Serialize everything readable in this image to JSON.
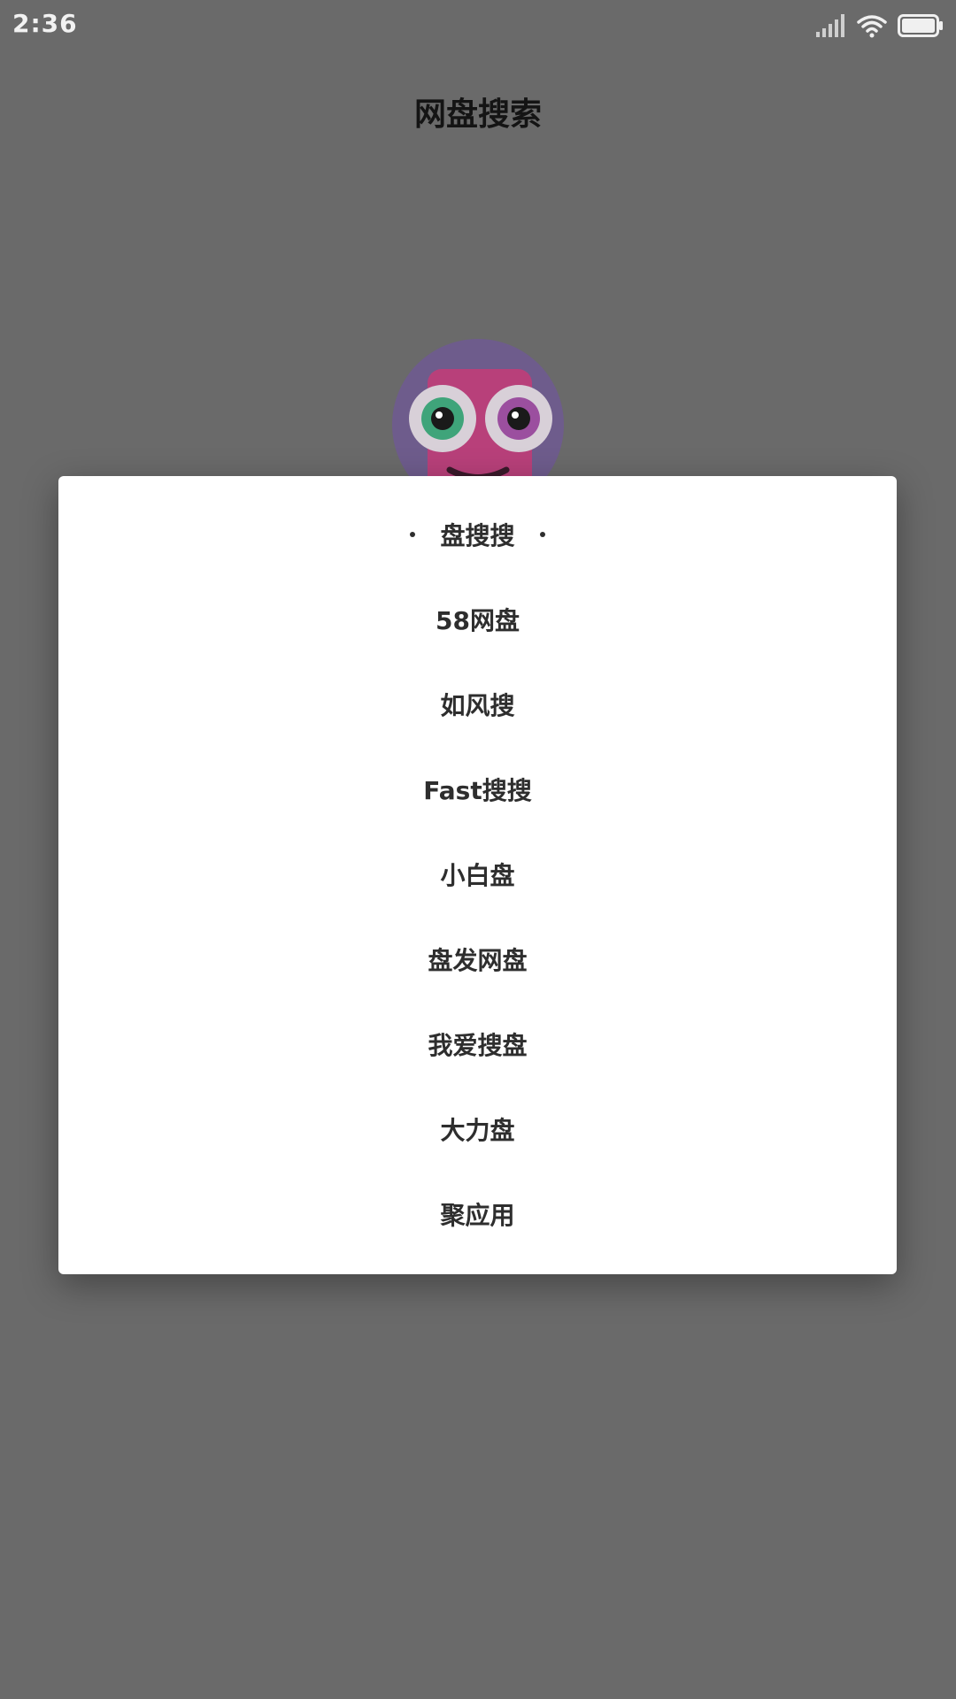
{
  "status_bar": {
    "time": "2:36",
    "icons": [
      "signal-icon",
      "wifi-icon",
      "battery-icon"
    ],
    "battery_level": 1.0
  },
  "header": {
    "title": "网盘搜索"
  },
  "colors": {
    "overlay": "#6a6a6a",
    "dialog_bg": "#ffffff",
    "option_text": "#2e2e2e",
    "title_text": "#141414",
    "mascot_circle": "#6e5c8c",
    "mascot_face": "#b8407a"
  },
  "dialog": {
    "selected_index": 0,
    "options": [
      {
        "label": "盘搜搜"
      },
      {
        "label": "58网盘"
      },
      {
        "label": "如风搜"
      },
      {
        "label": "Fast搜搜"
      },
      {
        "label": "小白盘"
      },
      {
        "label": "盘发网盘"
      },
      {
        "label": "我爱搜盘"
      },
      {
        "label": "大力盘"
      },
      {
        "label": "聚应用"
      }
    ]
  }
}
